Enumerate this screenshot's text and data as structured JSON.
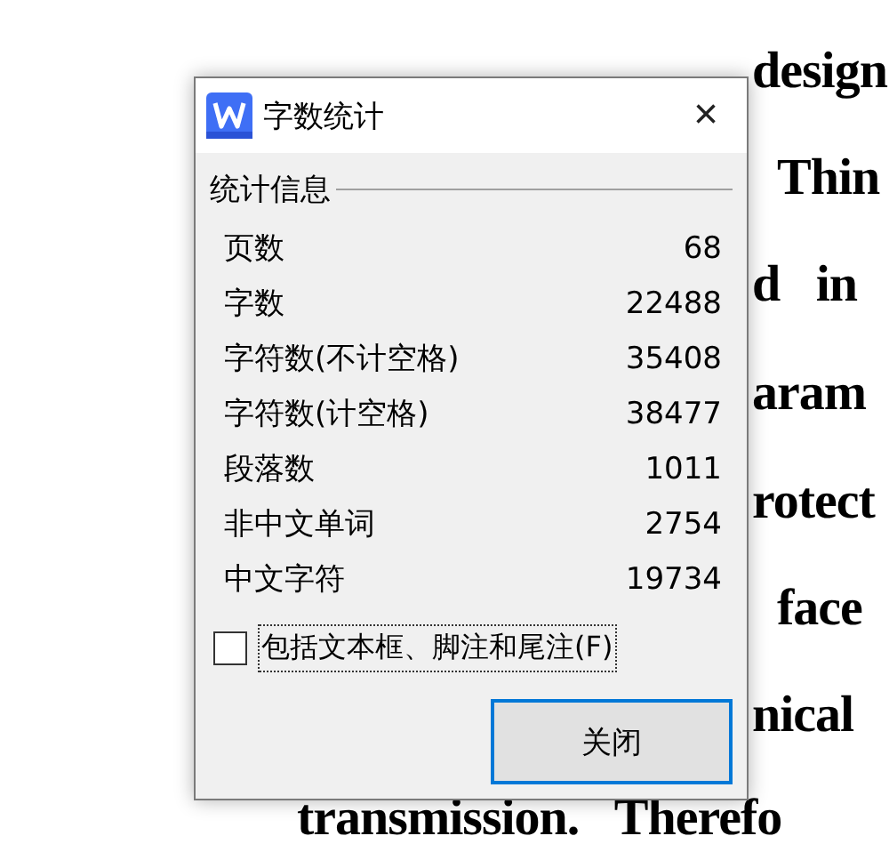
{
  "document": {
    "lines": [
      {
        "text": "design"
      },
      {
        "text": "Thin"
      },
      {
        "text": "d   in"
      },
      {
        "text": "aram"
      },
      {
        "text": "rotect"
      },
      {
        "text": "face"
      },
      {
        "text": "nical"
      },
      {
        "text": "transmission.   Therefo"
      }
    ]
  },
  "dialog": {
    "title": "字数统计",
    "close": "×",
    "group_label": "统计信息",
    "stats": [
      {
        "label": "页数",
        "value": "68"
      },
      {
        "label": "字数",
        "value": "22488"
      },
      {
        "label": "字符数(不计空格)",
        "value": "35408"
      },
      {
        "label": "字符数(计空格)",
        "value": "38477"
      },
      {
        "label": "段落数",
        "value": "1011"
      },
      {
        "label": "非中文单词",
        "value": "2754"
      },
      {
        "label": "中文字符",
        "value": "19734"
      }
    ],
    "include_checkbox": {
      "label": "包括文本框、脚注和尾注(F)",
      "checked": false
    },
    "buttons": [
      "关闭"
    ]
  }
}
